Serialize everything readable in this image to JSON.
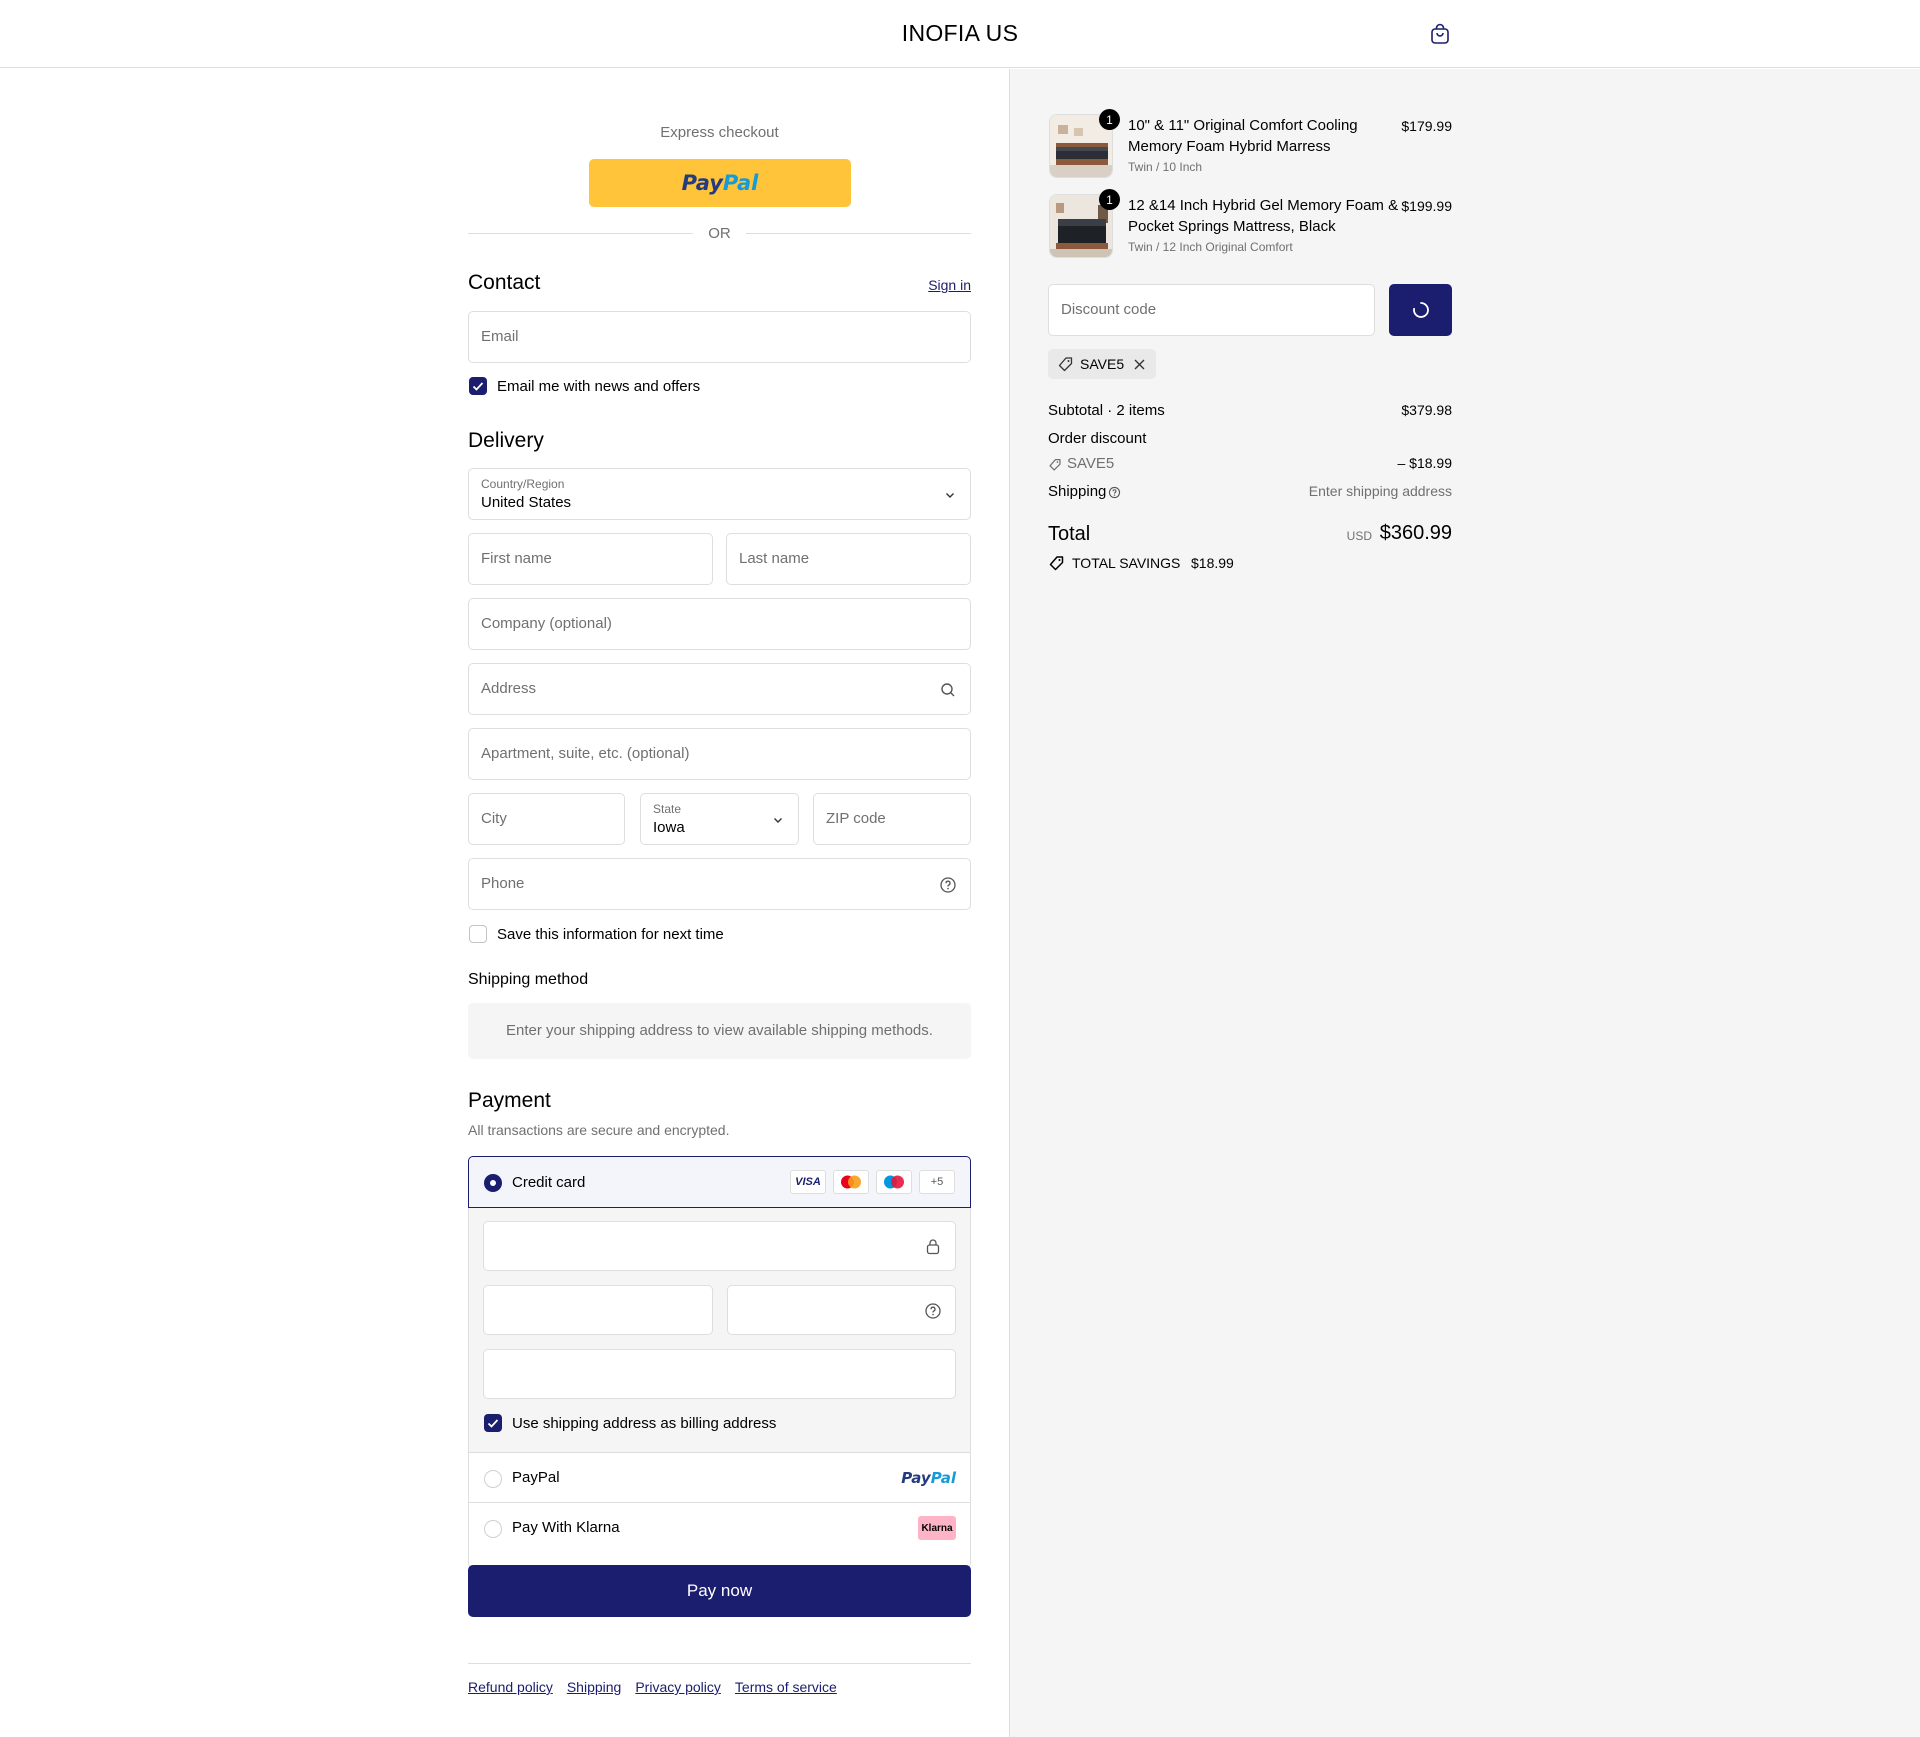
{
  "header": {
    "store_name": "INOFIA US",
    "cart_icon": "shopping-bag-icon"
  },
  "express": {
    "title": "Express checkout",
    "paypal_logo_a": "Pay",
    "paypal_logo_b": "Pal",
    "or_text": "OR"
  },
  "contact": {
    "title": "Contact",
    "sign_in": "Sign in",
    "email_placeholder": "Email",
    "newsletter_label": "Email me with news and offers",
    "newsletter_checked": true
  },
  "delivery": {
    "title": "Delivery",
    "country_label": "Country/Region",
    "country_value": "United States",
    "first_name_placeholder": "First name",
    "last_name_placeholder": "Last name",
    "company_placeholder": "Company (optional)",
    "address_placeholder": "Address",
    "apartment_placeholder": "Apartment, suite, etc. (optional)",
    "city_placeholder": "City",
    "state_label": "State",
    "state_value": "Iowa",
    "zip_placeholder": "ZIP code",
    "phone_placeholder": "Phone",
    "save_info_label": "Save this information for next time",
    "save_info_checked": false
  },
  "shipping_method": {
    "title": "Shipping method",
    "message": "Enter your shipping address to view available shipping methods."
  },
  "payment": {
    "title": "Payment",
    "subtitle": "All transactions are secure and encrypted.",
    "credit_card_label": "Credit card",
    "card_brands": [
      "VISA",
      "+5"
    ],
    "billing_label": "Use shipping address as billing address",
    "billing_checked": true,
    "paypal_label": "PayPal",
    "klarna_label": "Pay With Klarna",
    "klarna_badge": "Klarna",
    "pay_now": "Pay now"
  },
  "footer": {
    "links": [
      "Refund policy",
      "Shipping",
      "Privacy policy",
      "Terms of service"
    ]
  },
  "order": {
    "items": [
      {
        "name_line1": "10\" & 11\" Original Comfort Cooling",
        "name_line2": "Memory Foam Hybrid Marress",
        "variant": "Twin / 10 Inch",
        "price": "$179.99",
        "qty": "1"
      },
      {
        "name_line1": "12 &14 Inch Hybrid Gel Memory Foam &",
        "name_line2": "Pocket Springs Mattress, Black",
        "variant": "Twin / 12 Inch Original Comfort",
        "price": "$199.99",
        "qty": "1"
      }
    ],
    "discount_placeholder": "Discount code",
    "applied_code": "SAVE5",
    "subtotal_label": "Subtotal · 2 items",
    "subtotal_value": "$379.98",
    "order_discount_label": "Order discount",
    "discount_code": "SAVE5",
    "discount_value": "– $18.99",
    "shipping_label": "Shipping",
    "shipping_value": "Enter shipping address",
    "total_label": "Total",
    "currency": "USD",
    "total_value": "$360.99",
    "total_savings_label": "TOTAL SAVINGS",
    "total_savings_value": "$18.99"
  },
  "colors": {
    "primary": "#1b1d6e",
    "paypal_yellow": "#ffc439",
    "klarna_pink": "#ffb3c7",
    "muted": "#707070",
    "border": "#dedede",
    "summary_bg": "#f5f5f5"
  }
}
